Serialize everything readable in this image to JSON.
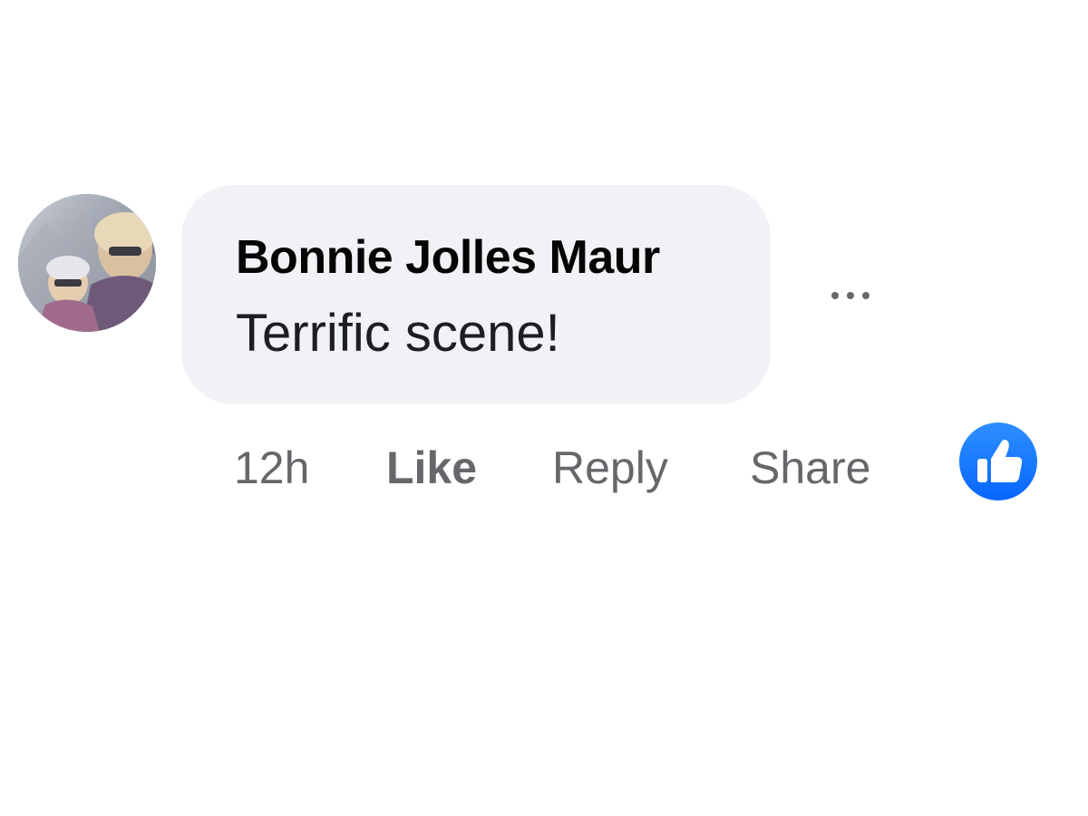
{
  "comment": {
    "author": "Bonnie Jolles Maur",
    "text": "Terrific scene!",
    "timestamp": "12h",
    "actions": {
      "like": "Like",
      "reply": "Reply",
      "share": "Share"
    },
    "reaction_icon": "thumbs-up-icon",
    "more_icon": "more-options-icon",
    "colors": {
      "bubble": "#f0f2f5",
      "reaction_blue": "#0866ff",
      "secondary_text": "#65676b"
    }
  }
}
